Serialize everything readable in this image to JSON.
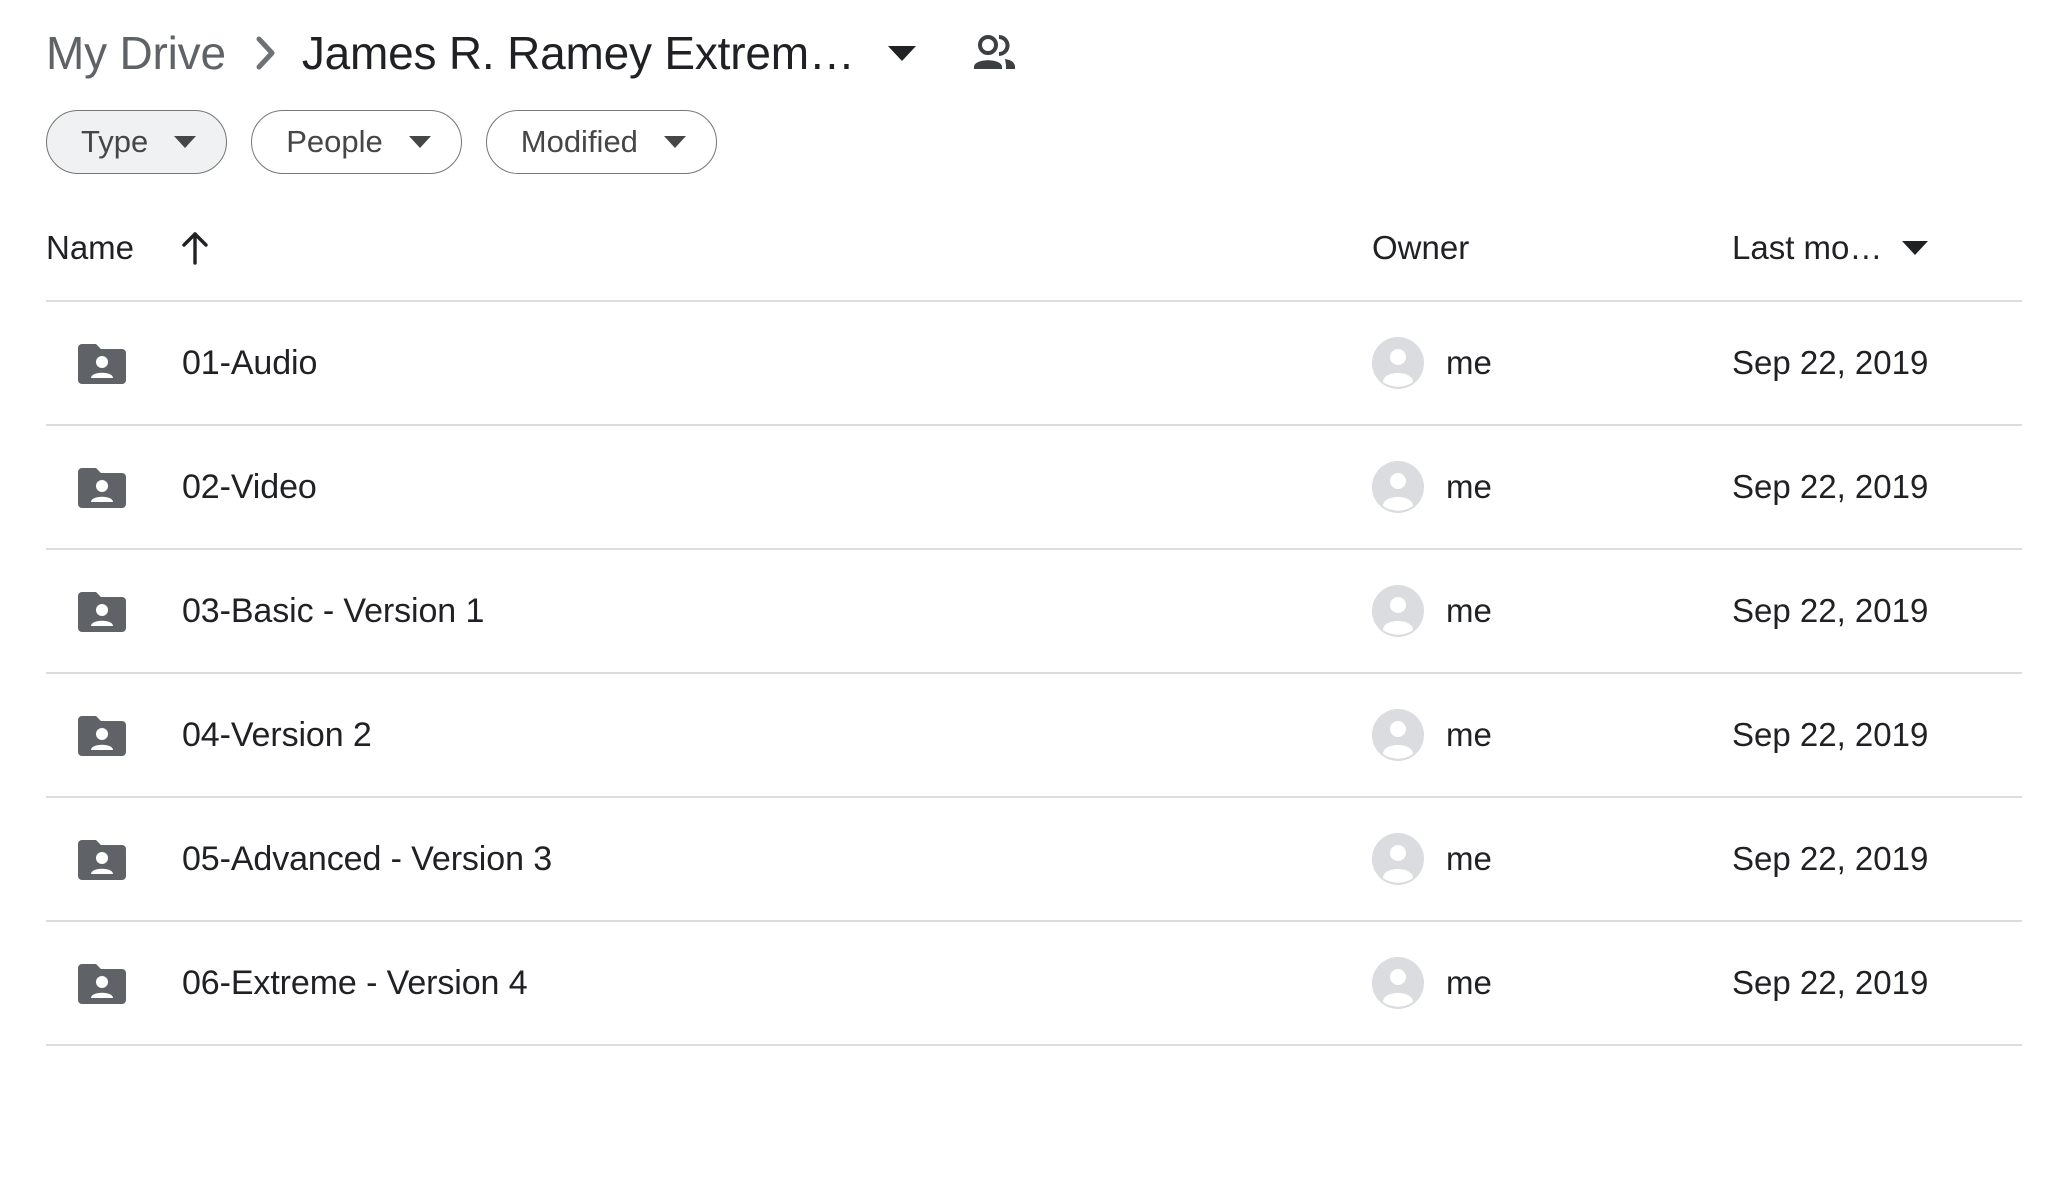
{
  "breadcrumb": {
    "root_label": "My Drive",
    "separator_icon": "chevron-right-icon",
    "current_label": "James R. Ramey Extrem…",
    "caret_icon": "chevron-down-icon",
    "share_icon": "people-shared-icon"
  },
  "filters": {
    "chips": [
      {
        "label": "Type",
        "selected": true,
        "caret_icon": "chevron-down-icon"
      },
      {
        "label": "People",
        "selected": false,
        "caret_icon": "chevron-down-icon"
      },
      {
        "label": "Modified",
        "selected": false,
        "caret_icon": "chevron-down-icon"
      }
    ]
  },
  "list_header": {
    "name": "Name",
    "sort_icon": "arrow-up-icon",
    "owner": "Owner",
    "modified": "Last mo…",
    "modified_caret_icon": "chevron-down-icon"
  },
  "rows": [
    {
      "icon": "shared-folder-icon",
      "name": "01-Audio",
      "owner": "me",
      "modified": "Sep 22, 2019"
    },
    {
      "icon": "shared-folder-icon",
      "name": "02-Video",
      "owner": "me",
      "modified": "Sep 22, 2019"
    },
    {
      "icon": "shared-folder-icon",
      "name": "03-Basic - Version 1",
      "owner": "me",
      "modified": "Sep 22, 2019"
    },
    {
      "icon": "shared-folder-icon",
      "name": "04-Version 2",
      "owner": "me",
      "modified": "Sep 22, 2019"
    },
    {
      "icon": "shared-folder-icon",
      "name": "05-Advanced - Version 3",
      "owner": "me",
      "modified": "Sep 22, 2019"
    },
    {
      "icon": "shared-folder-icon",
      "name": "06-Extreme - Version 4",
      "owner": "me",
      "modified": "Sep 22, 2019"
    }
  ],
  "colors": {
    "text_primary": "#202124",
    "text_secondary": "#5f6368",
    "folder_icon": "#5f6368",
    "avatar_bg": "#dadce0",
    "divider": "#dadce0",
    "chip_border": "#747775",
    "chip_selected_bg": "#f0f1f2"
  }
}
